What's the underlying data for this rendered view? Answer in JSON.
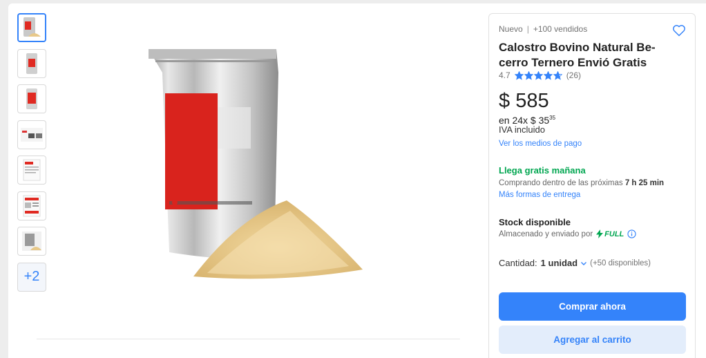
{
  "product": {
    "condition": "Nuevo",
    "sold": "+100 vendidos",
    "title": "Calostro Bovino Natural Be­cerro Ternero Envió Gratis",
    "rating": "4.7",
    "rating_value": 4.7,
    "reviews": "(26)"
  },
  "gallery": {
    "more_label": "+2"
  },
  "price": {
    "currency": "$",
    "amount": "585",
    "installments_prefix": "en 24x $ 35",
    "installments_cents": "35",
    "tax": "IVA incluido",
    "payment_link": "Ver los medios de pago"
  },
  "shipping": {
    "title": "Llega gratis mañana",
    "countdown_prefix": "Comprando dentro de las próximas",
    "countdown": "7 h 25 min",
    "link": "Más formas de entrega"
  },
  "stock": {
    "title": "Stock disponible",
    "subtitle": "Almacenado y enviado por",
    "full_label": "FULL"
  },
  "quantity": {
    "label": "Cantidad:",
    "value": "1 unidad",
    "available": "(+50 disponibles)"
  },
  "actions": {
    "buy_label": "Comprar ahora",
    "cart_label": "Agregar al carrito"
  },
  "colors": {
    "accent": "#3483fa",
    "success": "#00a650"
  },
  "icons": {
    "favorite": "heart-icon",
    "star": "star-icon",
    "full": "lightning-icon",
    "info": "info-icon",
    "dropdown": "chevron-down-icon"
  }
}
